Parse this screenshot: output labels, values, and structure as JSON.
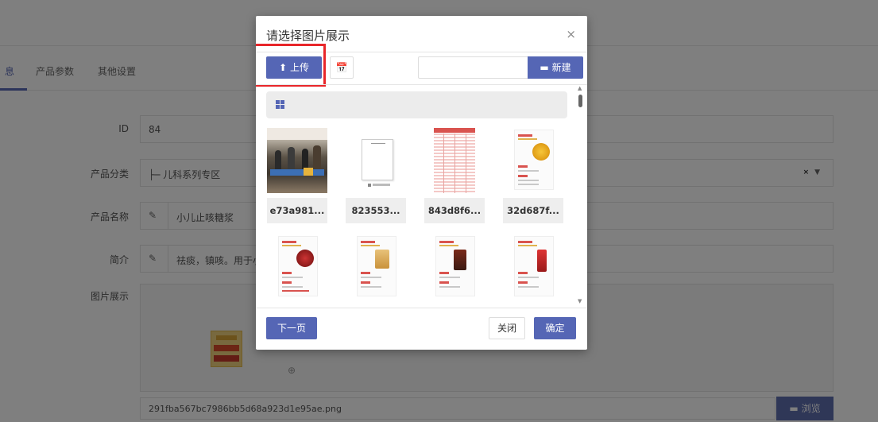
{
  "background": {
    "tabs": [
      {
        "label": "息"
      },
      {
        "label": "产品参数"
      },
      {
        "label": "其他设置"
      }
    ],
    "fields": {
      "id_label": "ID",
      "id_value": "84",
      "category_label": "产品分类",
      "category_value": "├─ 儿科系列专区",
      "category_clear": "×",
      "category_arrow": "▼",
      "name_label": "产品名称",
      "name_value": "小儿止咳糖浆",
      "intro_label": "简介",
      "intro_value": "祛痰，镇咳。用于小儿",
      "gallery_label": "图片展示"
    },
    "image_path": "291fba567bc7986bb5d68a923d1e95ae.png",
    "browse_label": "浏览",
    "folder_icon": "folder-icon",
    "zoom_icon": "zoom-in-icon"
  },
  "modal": {
    "title": "请选择图片展示",
    "close_glyph": "×",
    "toolbar": {
      "upload_label": "上传",
      "upload_icon": "upload-icon",
      "calendar_icon": "calendar-icon",
      "new_input_value": "",
      "new_label": "新建",
      "new_icon": "folder-icon"
    },
    "folder_bar_icon": "grid-icon",
    "images": [
      {
        "name": "e73a981...",
        "kind": "photo"
      },
      {
        "name": "823553...",
        "kind": "document"
      },
      {
        "name": "843d8f6...",
        "kind": "table"
      },
      {
        "name": "32d687f...",
        "kind": "flyer"
      },
      {
        "name": "",
        "kind": "flyer"
      },
      {
        "name": "",
        "kind": "flyer"
      },
      {
        "name": "",
        "kind": "flyer"
      },
      {
        "name": "",
        "kind": "flyer"
      }
    ],
    "footer": {
      "next_label": "下一页",
      "close_label": "关闭",
      "ok_label": "确定"
    }
  },
  "colors": {
    "primary": "#5566b5",
    "highlight": "#e8262a",
    "overlay": "rgba(0,0,0,0.5)"
  }
}
